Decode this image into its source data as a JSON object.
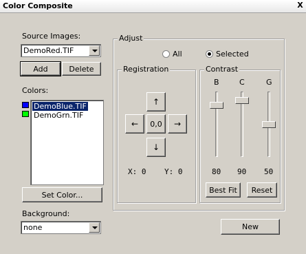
{
  "window": {
    "title": "Color Composite",
    "close_glyph": "X"
  },
  "source_images": {
    "label": "Source Images:",
    "selected": "DemoRed.TIF",
    "add_label": "Add",
    "delete_label": "Delete"
  },
  "colors": {
    "label": "Colors:",
    "items": [
      {
        "name": "DemoBlue.TIF",
        "color": "#0000ff",
        "selected": true
      },
      {
        "name": "DemoGrn.TIF",
        "color": "#00ff00",
        "selected": false
      }
    ],
    "set_color_label": "Set Color..."
  },
  "background": {
    "label": "Background:",
    "selected": "none"
  },
  "adjust": {
    "label": "Adjust",
    "radio_all": "All",
    "radio_selected": "Selected",
    "selected_option": "Selected"
  },
  "registration": {
    "label": "Registration",
    "up": "↑",
    "down": "↓",
    "left": "←",
    "right": "→",
    "center": "0,0",
    "x_readout": "X: 0",
    "y_readout": "Y: 0"
  },
  "contrast": {
    "label": "Contrast",
    "channels": [
      {
        "name": "B",
        "value": "80"
      },
      {
        "name": "C",
        "value": "90"
      },
      {
        "name": "G",
        "value": "50"
      }
    ],
    "best_fit_label": "Best Fit",
    "reset_label": "Reset"
  },
  "new_label": "New"
}
